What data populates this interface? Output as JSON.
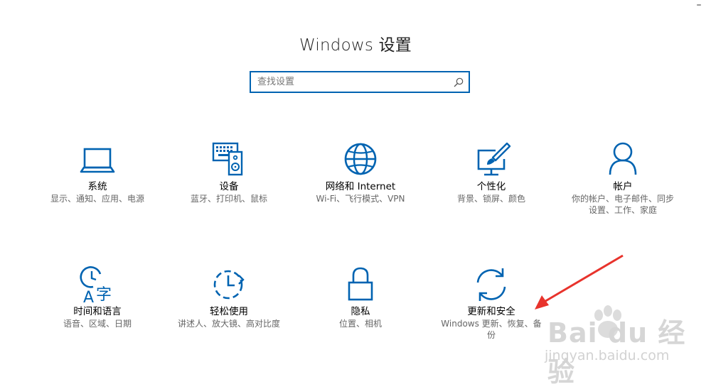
{
  "window": {
    "minimize_glyph": "–"
  },
  "title": "Windows 设置",
  "search": {
    "placeholder": "查找设置",
    "icon": "search-icon"
  },
  "accent_color": "#0063b1",
  "tiles": [
    {
      "label": "系统",
      "desc": "显示、通知、应用、电源",
      "icon": "laptop-icon"
    },
    {
      "label": "设备",
      "desc": "蓝牙、打印机、鼠标",
      "icon": "keyboard-speaker-icon"
    },
    {
      "label": "网络和 Internet",
      "desc": "Wi-Fi、飞行模式、VPN",
      "icon": "globe-icon"
    },
    {
      "label": "个性化",
      "desc": "背景、锁屏、颜色",
      "icon": "paint-monitor-icon"
    },
    {
      "label": "帐户",
      "desc": "你的帐户、电子邮件、同步设置、工作、家庭",
      "icon": "person-icon"
    },
    {
      "label": "时间和语言",
      "desc": "语音、区域、日期",
      "icon": "clock-language-icon"
    },
    {
      "label": "轻松使用",
      "desc": "讲述人、放大镜、高对比度",
      "icon": "ease-of-access-icon"
    },
    {
      "label": "隐私",
      "desc": "位置、相机",
      "icon": "lock-icon"
    },
    {
      "label": "更新和安全",
      "desc": "Windows 更新、恢复、备份",
      "icon": "sync-icon"
    }
  ],
  "watermark": {
    "brand": "Bai du 经验",
    "url": "jingyan.baidu.com"
  },
  "annotation": {
    "arrow_color": "#e8332c"
  }
}
